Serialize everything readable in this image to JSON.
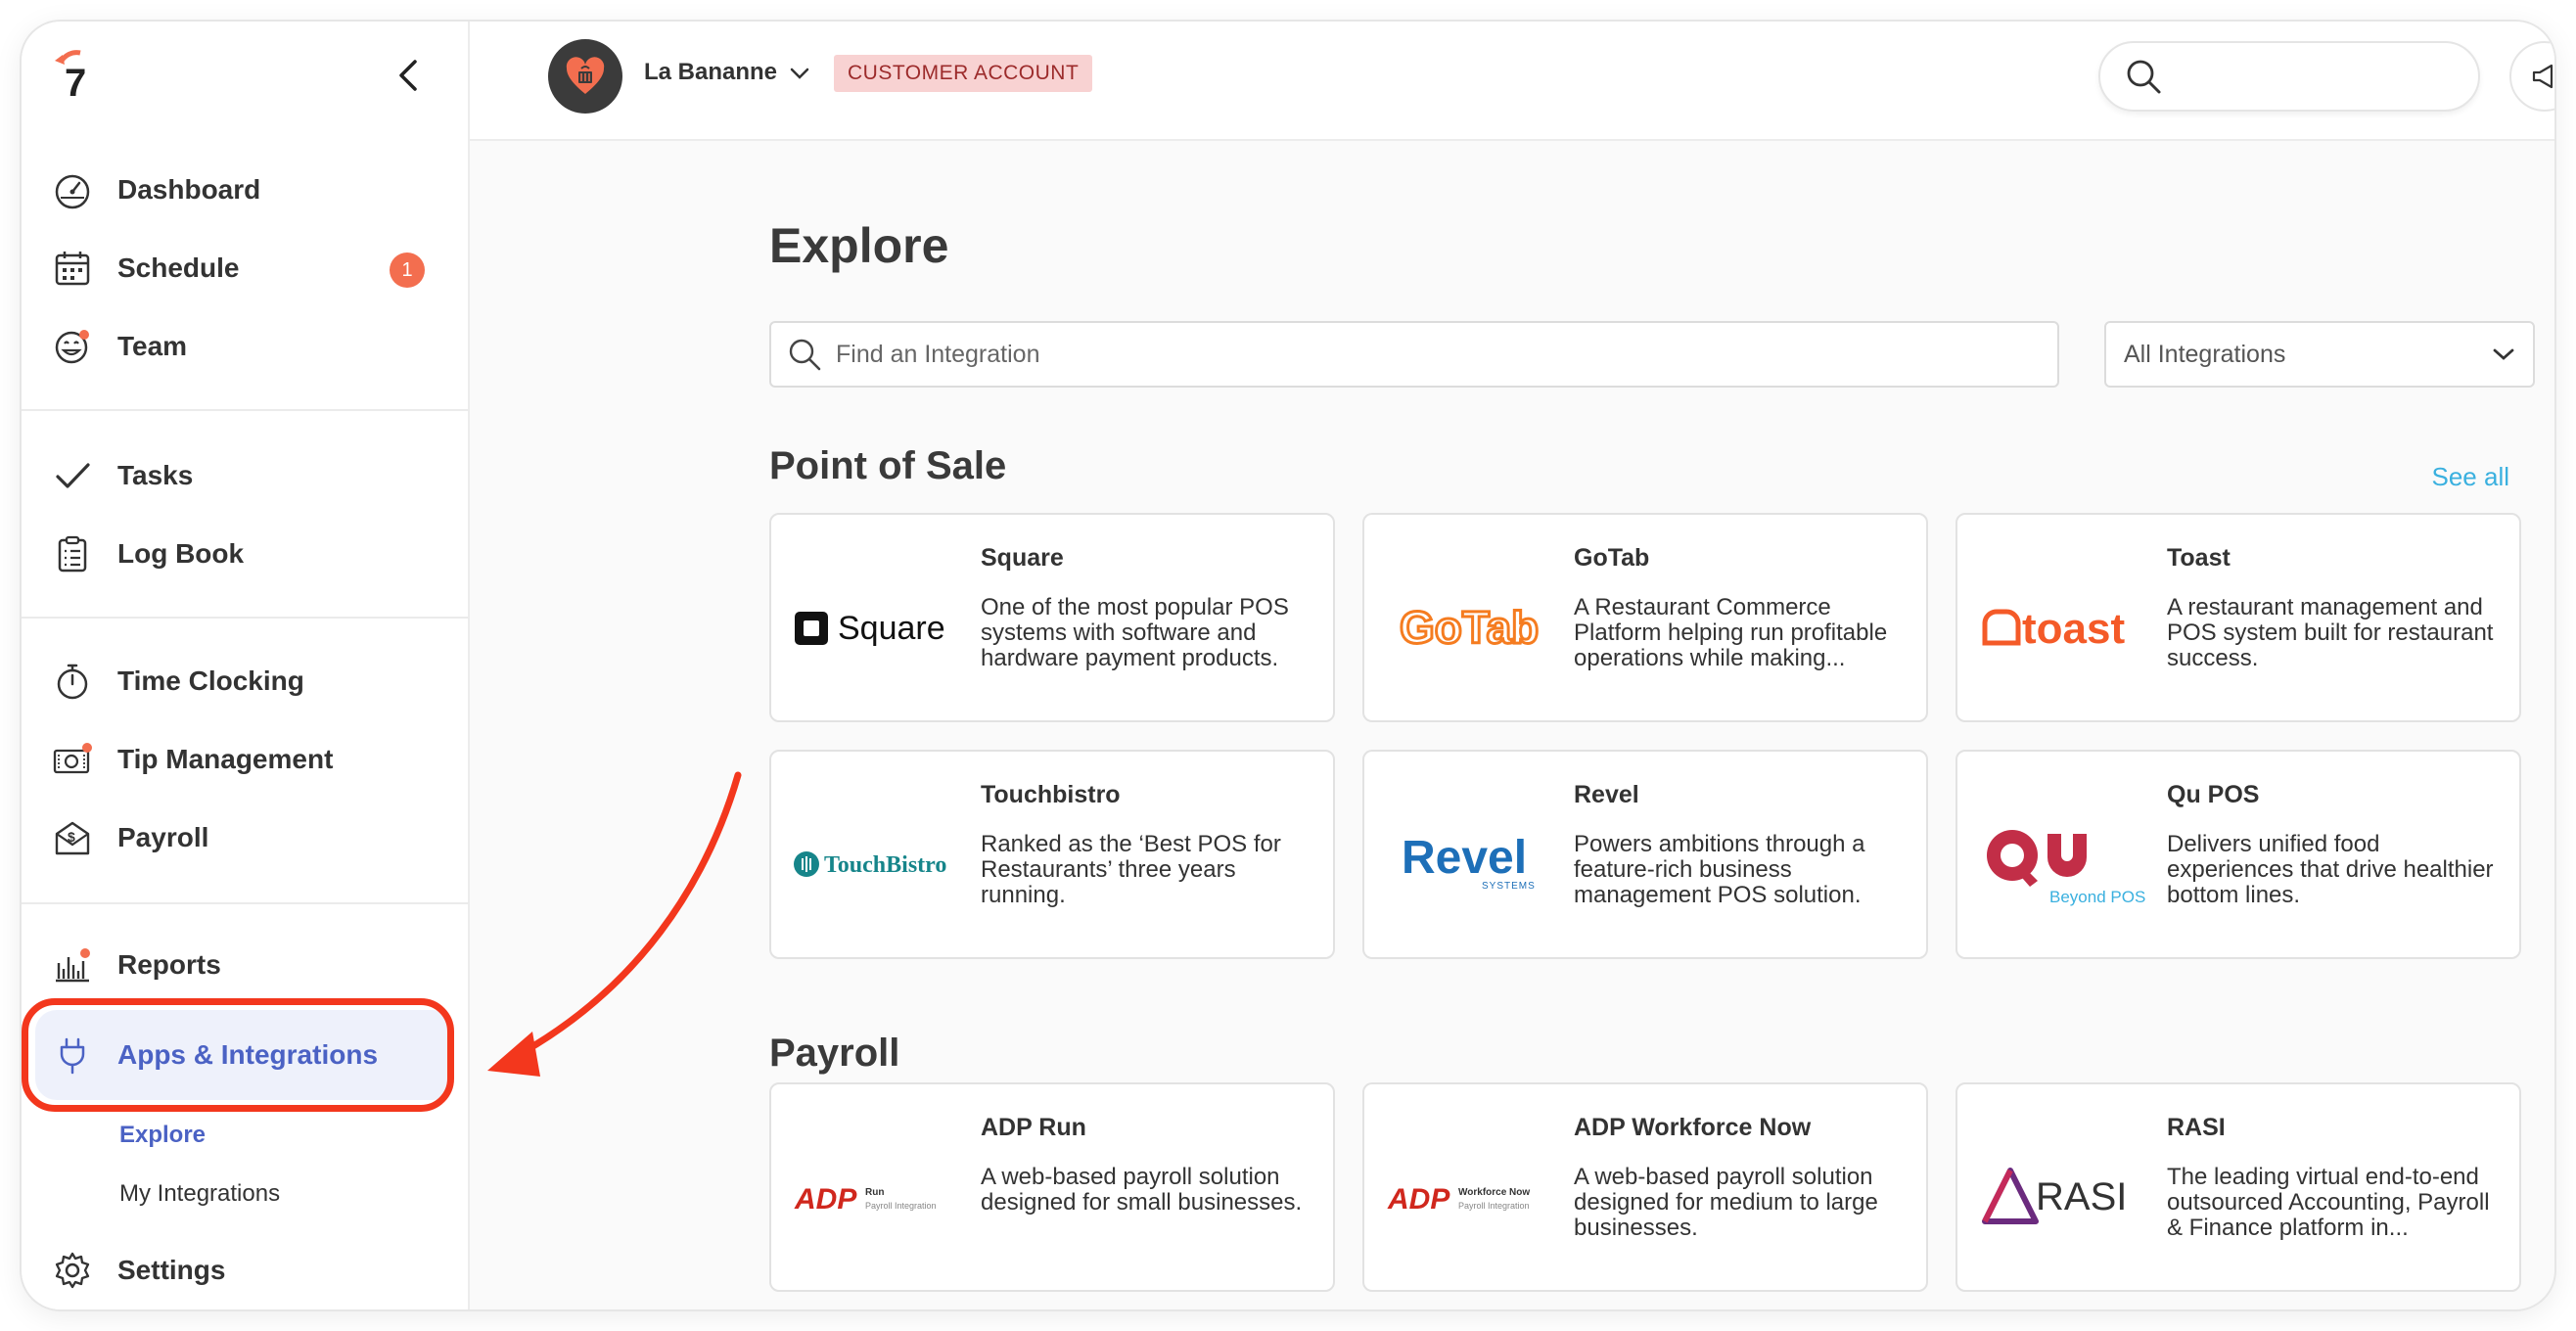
{
  "header": {
    "account_name": "La Bananne",
    "account_badge": "CUSTOMER ACCOUNT",
    "search_placeholder": ""
  },
  "sidebar": {
    "logo_text": "7",
    "items": [
      {
        "label": "Dashboard",
        "icon": "dashboard-gauge-icon"
      },
      {
        "label": "Schedule",
        "icon": "calendar-icon",
        "badge": "1"
      },
      {
        "label": "Team",
        "icon": "smiley-face-icon"
      },
      {
        "label": "Tasks",
        "icon": "checkmark-icon"
      },
      {
        "label": "Log Book",
        "icon": "clipboard-icon"
      },
      {
        "label": "Time Clocking",
        "icon": "stopwatch-icon"
      },
      {
        "label": "Tip Management",
        "icon": "cash-icon"
      },
      {
        "label": "Payroll",
        "icon": "money-envelope-icon"
      },
      {
        "label": "Reports",
        "icon": "bar-chart-icon"
      },
      {
        "label": "Apps & Integrations",
        "icon": "plug-icon"
      },
      {
        "label": "Settings",
        "icon": "gear-icon"
      }
    ],
    "sub_items": [
      {
        "label": "Explore",
        "active": true
      },
      {
        "label": "My Integrations",
        "active": false
      }
    ]
  },
  "main": {
    "title": "Explore",
    "search_placeholder": "Find an Integration",
    "filter_value": "All Integrations",
    "sections": [
      {
        "title": "Point of Sale",
        "see_all": "See all",
        "cards": [
          {
            "name": "Square",
            "logo_text": "Square",
            "description": "One of the most popular POS systems with software and hardware payment products."
          },
          {
            "name": "GoTab",
            "logo_text": "GoTab",
            "description": "A Restaurant Commerce Platform helping run profitable operations while making..."
          },
          {
            "name": "Toast",
            "logo_text": "toast",
            "description": "A restaurant management and POS system built for restaurant success."
          },
          {
            "name": "Touchbistro",
            "logo_text": "TouchBistro",
            "description": "Ranked as the ‘Best POS for Restaurants’ three years running."
          },
          {
            "name": "Revel",
            "logo_text": "Revel",
            "logo_sub": "SYSTEMS",
            "description": "Powers ambitions through a feature-rich business management POS solution."
          },
          {
            "name": "Qu POS",
            "logo_text": "QU",
            "logo_sub": "Beyond POS",
            "description": "Delivers unified food experiences that drive healthier bottom lines."
          }
        ]
      },
      {
        "title": "Payroll",
        "cards": [
          {
            "name": "ADP Run",
            "logo_text": "ADP",
            "logo_sub": "Run",
            "logo_sub2": "Payroll Integration",
            "description": "A web-based payroll solution designed for small businesses."
          },
          {
            "name": "ADP Workforce Now",
            "logo_text": "ADP",
            "logo_sub": "Workforce Now",
            "logo_sub2": "Payroll Integration",
            "description": "A web-based payroll solution designed for medium to large businesses."
          },
          {
            "name": "RASI",
            "logo_text": "RASI",
            "description": "The leading virtual end-to-end outsourced Accounting, Payroll & Finance platform in..."
          }
        ]
      }
    ]
  },
  "colors": {
    "brand_orange": "#f36e4f",
    "active_blue": "#4b62c4",
    "link_blue": "#3ab0df",
    "annotation_red": "#f3371d"
  }
}
